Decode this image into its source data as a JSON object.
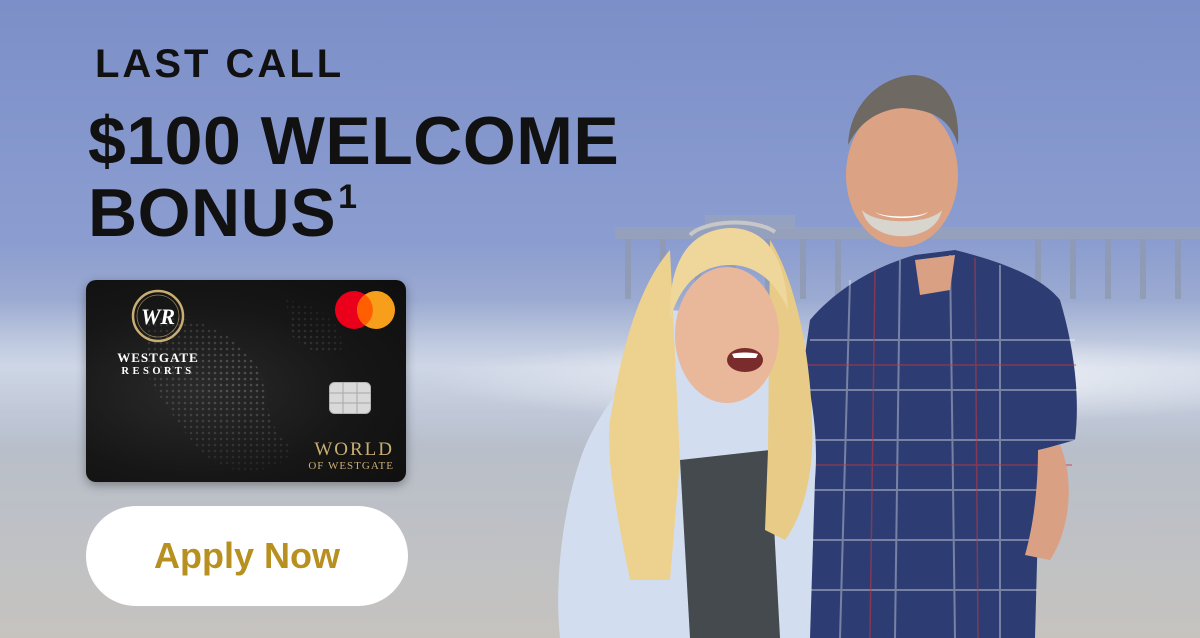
{
  "banner": {
    "eyebrow": "LAST CALL",
    "headline_line1": "$100 WELCOME",
    "headline_line2": "BONUS",
    "footnote_marker": "1",
    "cta_label": "Apply Now"
  },
  "card": {
    "logo_monogram": "WR",
    "logo_line1": "WESTGATE",
    "logo_line2": "RESORTS",
    "brand_line1": "WORLD",
    "brand_line2": "OF WESTGATE",
    "network_icon": "mastercard-logo"
  },
  "colors": {
    "cta_text": "#b8901f",
    "card_gold": "#c9ae73",
    "mastercard_red": "#eb001b",
    "mastercard_orange": "#f79e1b",
    "headline": "#111111"
  }
}
